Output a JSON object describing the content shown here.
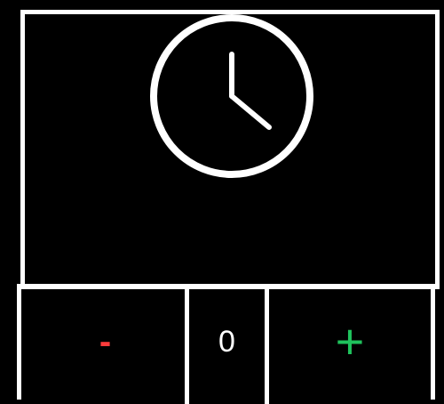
{
  "display": {
    "icon": "clock-icon"
  },
  "controls": {
    "decrement_label": "-",
    "value": "0",
    "increment_label": "+"
  },
  "colors": {
    "decrement": "#ff3b3b",
    "increment": "#1fc25c",
    "border": "#ffffff",
    "background": "#000000"
  }
}
